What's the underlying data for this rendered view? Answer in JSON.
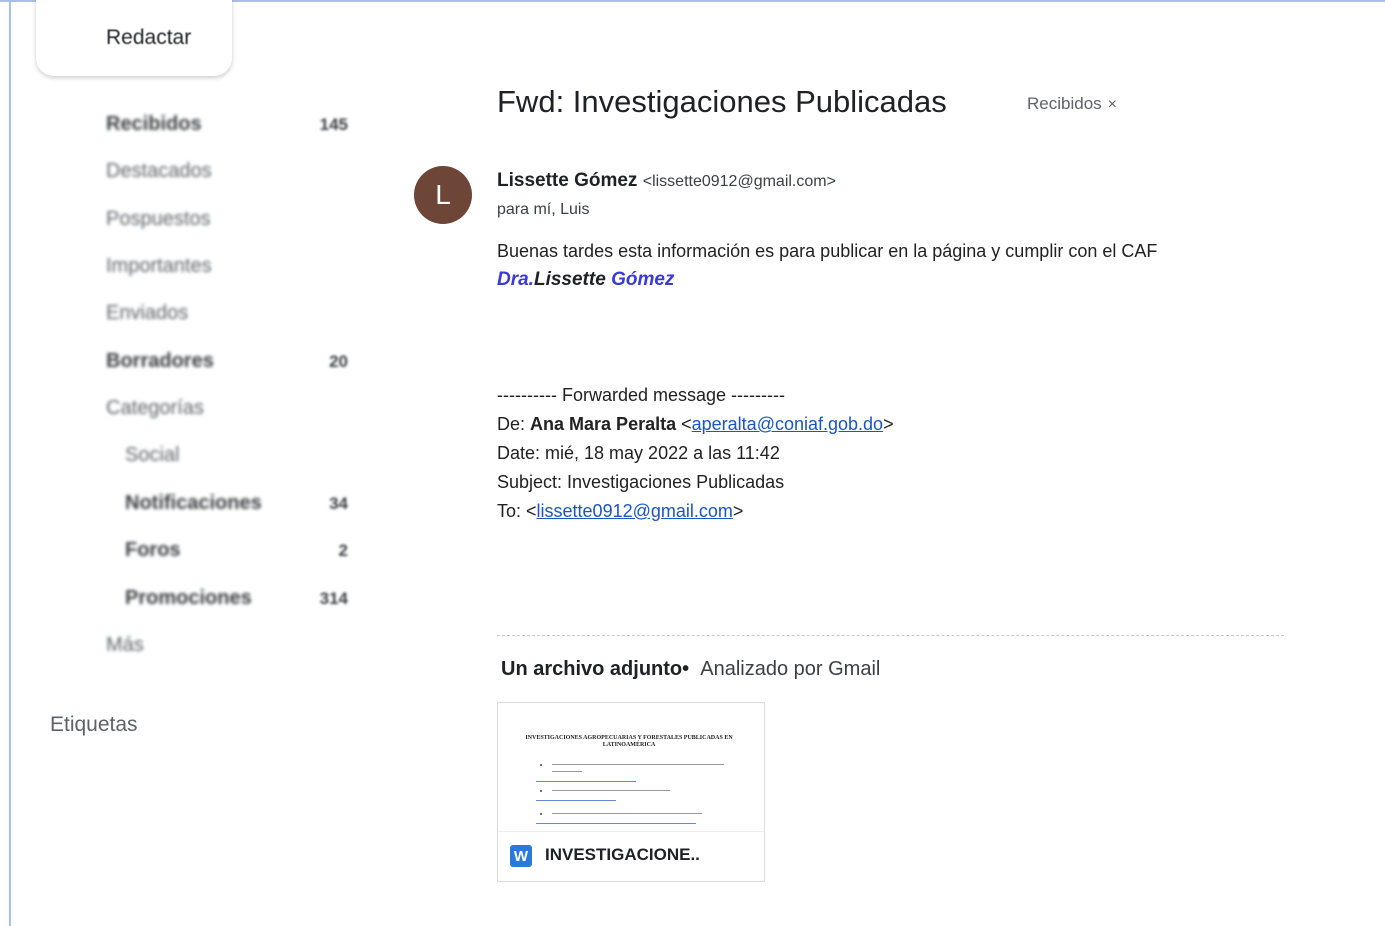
{
  "sidebar": {
    "compose_label": "Redactar",
    "items": [
      {
        "label": "Recibidos",
        "count": "145",
        "bold": true
      },
      {
        "label": "Destacados",
        "count": "",
        "bold": false
      },
      {
        "label": "Pospuestos",
        "count": "",
        "bold": false
      },
      {
        "label": "Importantes",
        "count": "",
        "bold": false
      },
      {
        "label": "Enviados",
        "count": "",
        "bold": false
      },
      {
        "label": "Borradores",
        "count": "20",
        "bold": true
      },
      {
        "label": "Categorías",
        "count": "",
        "bold": false
      },
      {
        "label": "Social",
        "count": "",
        "bold": false
      },
      {
        "label": "Notificaciones",
        "count": "34",
        "bold": true
      },
      {
        "label": "Foros",
        "count": "2",
        "bold": true
      },
      {
        "label": "Promociones",
        "count": "314",
        "bold": true
      },
      {
        "label": "Más",
        "count": "",
        "bold": false
      }
    ],
    "labels_heading": "Etiquetas"
  },
  "message": {
    "subject": "Fwd: Investigaciones Publicadas",
    "label_chip": "Recibidos",
    "label_remove": "×",
    "avatar_letter": "L",
    "sender_name": "Lissette Gómez",
    "sender_email": "<lissette0912@gmail.com>",
    "recipients": "para mí, Luis",
    "body": "Buenas tardes esta información es para publicar en la página y cumplir con el CAF",
    "signature": {
      "title": "Dra.",
      "first": "Lissette",
      "last": "Gómez"
    },
    "forwarded": {
      "separator": "---------- Forwarded message ---------",
      "from_label": "De:",
      "from_name": "Ana Mara Peralta",
      "from_lt": "<",
      "from_email": "aperalta@coniaf.gob.do",
      "from_gt": ">",
      "date": "Date: mié, 18 may 2022 a las 11:42",
      "subject": "Subject: Investigaciones Publicadas",
      "to_label": "To: <",
      "to_email": "lissette0912@gmail.com",
      "to_gt": ">"
    }
  },
  "attachments": {
    "count_label": "Un archivo adjunto",
    "separator": "•",
    "scan_label": "Analizado por Gmail",
    "file": {
      "icon_letter": "W",
      "name": "INVESTIGACIONE..",
      "preview_title": "INVESTIGACIONES AGROPECUARIAS Y FORESTALES PUBLICADAS EN LATINOAMÉRICA"
    }
  },
  "colors": {
    "avatar": "#6d4638",
    "signature_blue": "#3a3ad8",
    "link": "#1a55c4",
    "word_icon": "#2b79d9"
  }
}
